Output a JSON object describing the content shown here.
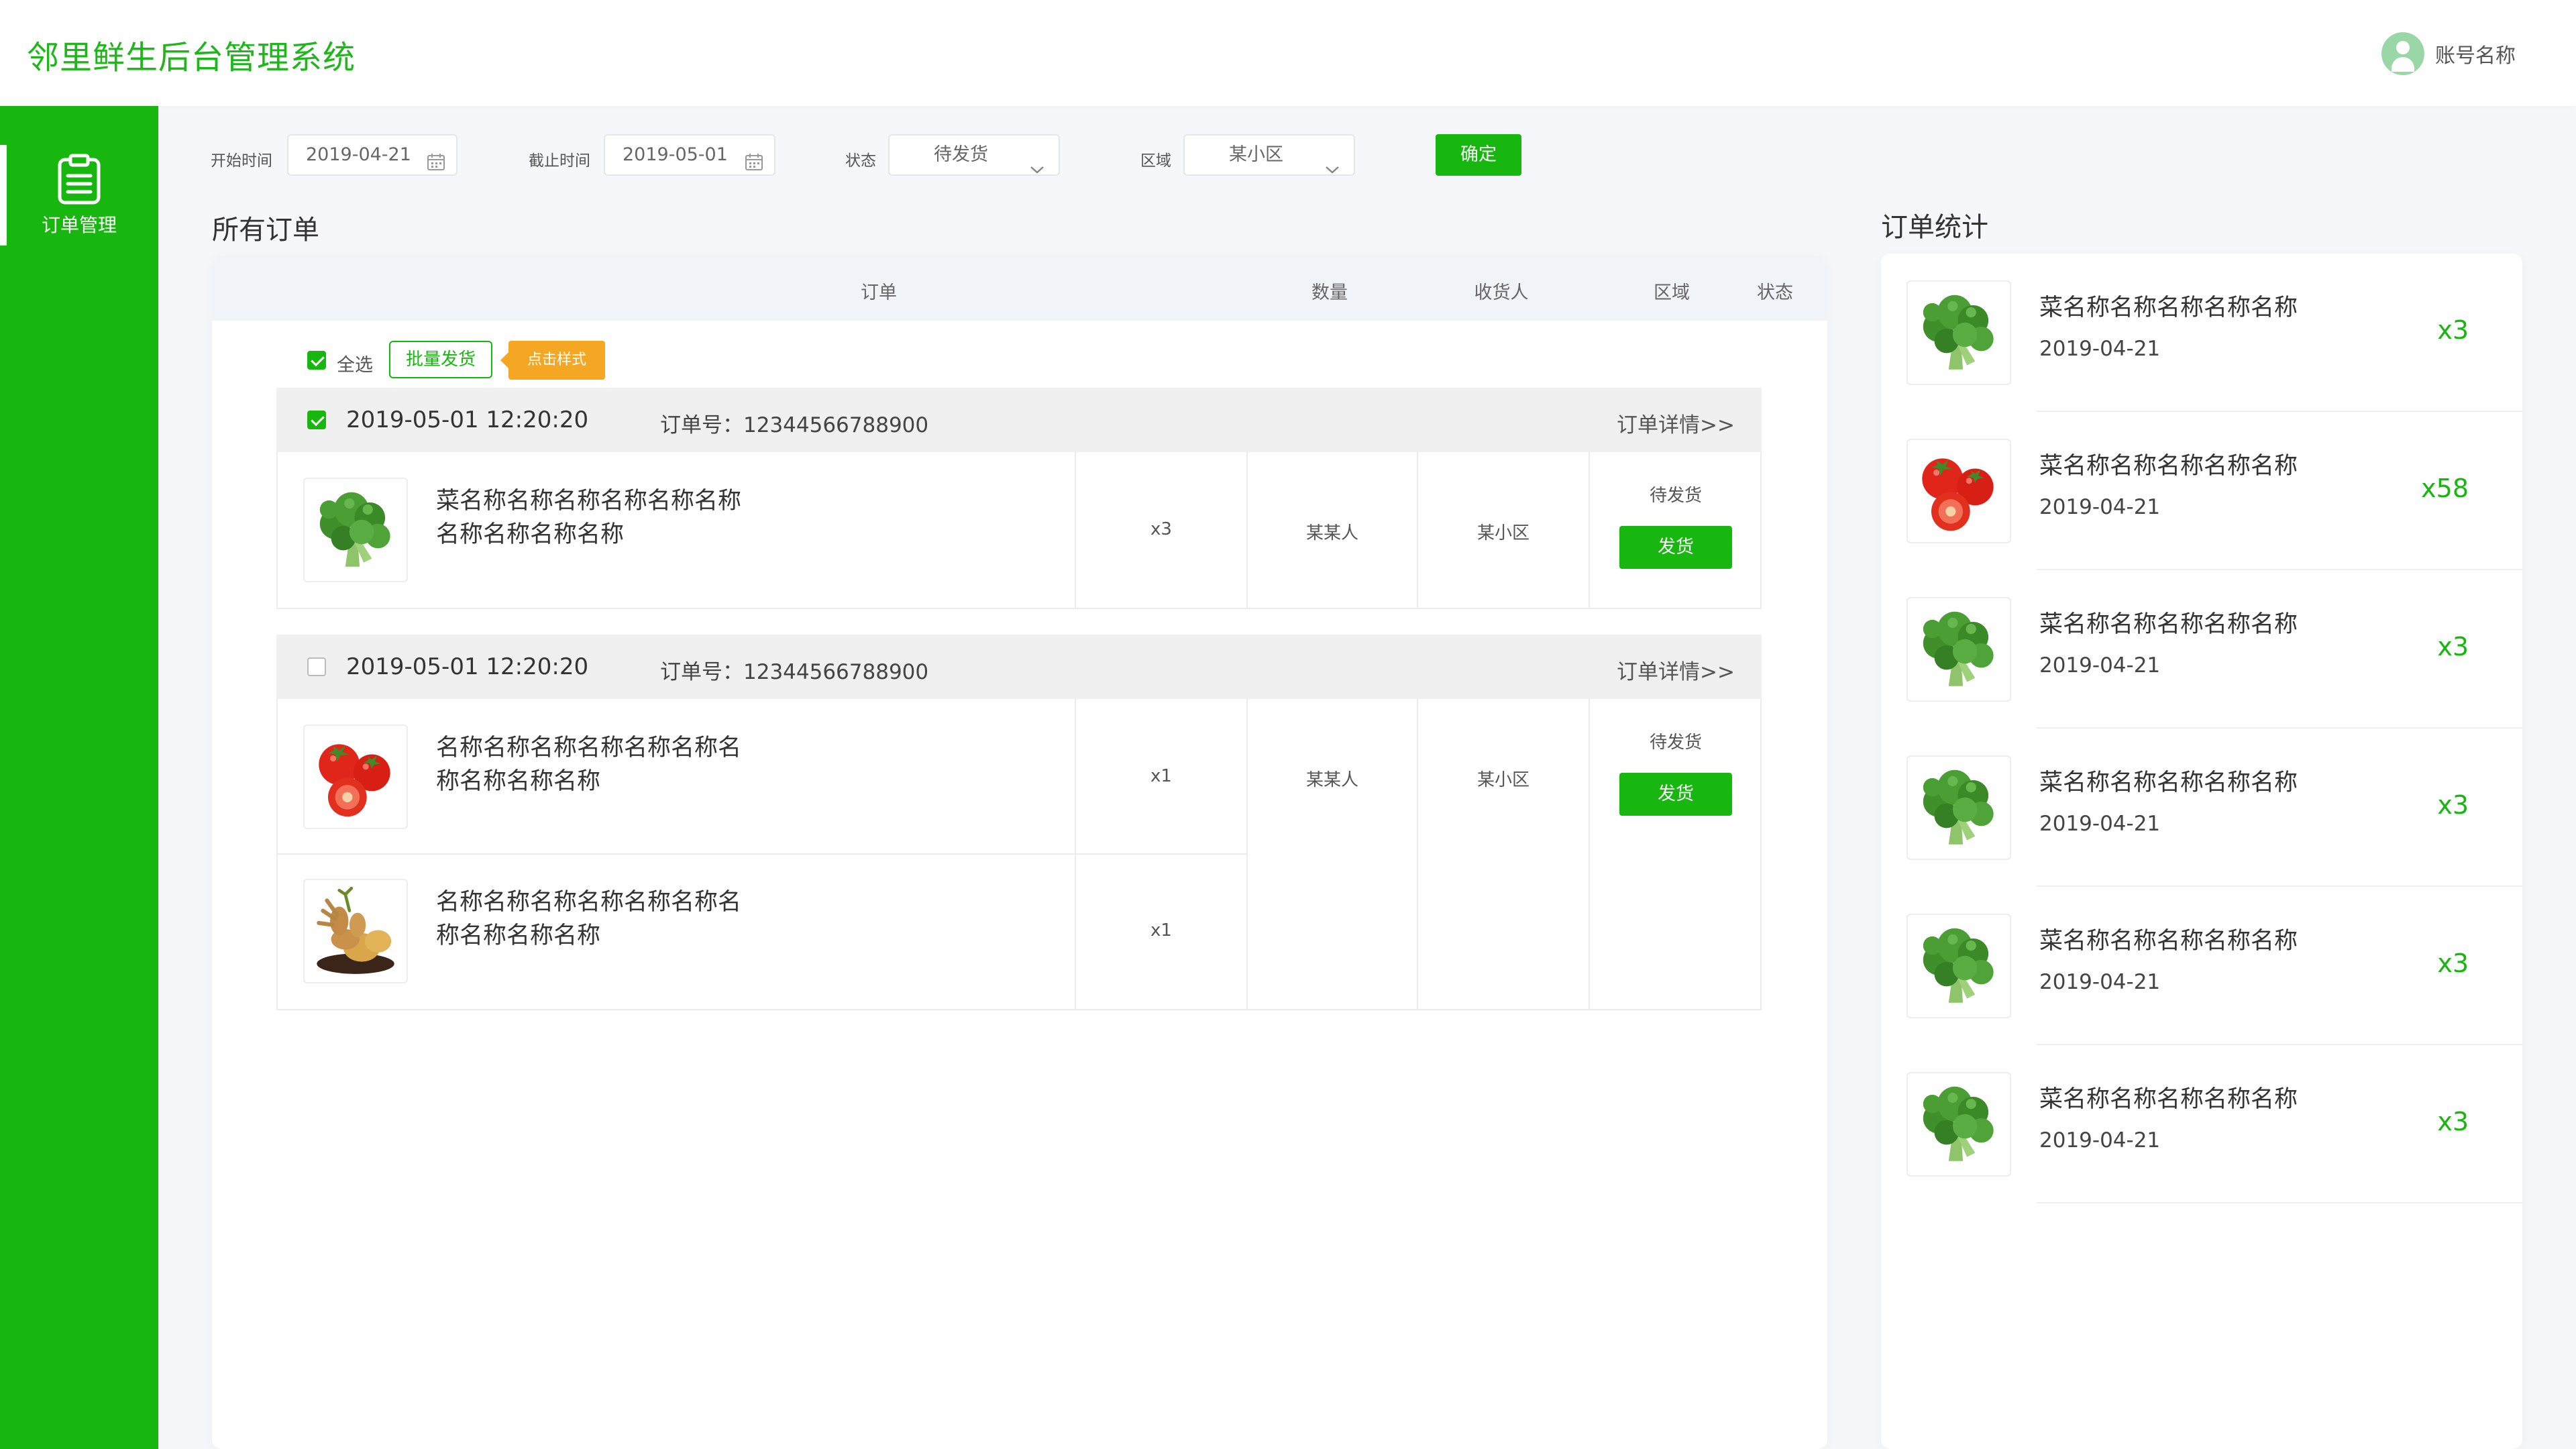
{
  "app": {
    "title": "邻里鲜生后台管理系统"
  },
  "account": {
    "name": "账号名称"
  },
  "sidebar": {
    "items": [
      {
        "label": "订单管理"
      }
    ]
  },
  "filters": {
    "start_label": "开始时间",
    "start_value": "2019-04-21",
    "end_label": "截止时间",
    "end_value": "2019-05-01",
    "status_label": "状态",
    "status_value": "待发货",
    "region_label": "区域",
    "region_value": "某小区",
    "confirm_label": "确定"
  },
  "orders": {
    "title": "所有订单",
    "columns": [
      "订单",
      "数量",
      "收货人",
      "区域",
      "状态"
    ],
    "select_all_label": "全选",
    "batch_label": "批量发货",
    "tip_label": "点击样式",
    "list": [
      {
        "checked": true,
        "time": "2019-05-01   12:20:20",
        "order_no": "订单号：12344566788900",
        "detail_link": "订单详情>>",
        "items": [
          {
            "image": "broccoli-image",
            "name": "菜名称名称名称名称名称名称名称名称名称名称",
            "qty": "x3"
          }
        ],
        "receiver": "某某人",
        "region": "某小区",
        "status": "待发货",
        "ship_label": "发货"
      },
      {
        "checked": false,
        "time": "2019-05-01   12:20:20",
        "order_no": "订单号：12344566788900",
        "detail_link": "订单详情>>",
        "items": [
          {
            "image": "tomato-image",
            "name": "名称名称名称名称名称名称名称名称名称名称",
            "qty": "x1"
          },
          {
            "image": "ginger-image",
            "name": "名称名称名称名称名称名称名称名称名称名称",
            "qty": "x1"
          }
        ],
        "receiver": "某某人",
        "region": "某小区",
        "status": "待发货",
        "ship_label": "发货"
      }
    ]
  },
  "stats": {
    "title": "订单统计",
    "items": [
      {
        "image": "broccoli-image",
        "name": "菜名称名称名称名称名称",
        "date": "2019-04-21",
        "qty": "x3"
      },
      {
        "image": "tomato-image",
        "name": "菜名称名称名称名称名称",
        "date": "2019-04-21",
        "qty": "x58"
      },
      {
        "image": "broccoli-image",
        "name": "菜名称名称名称名称名称",
        "date": "2019-04-21",
        "qty": "x3"
      },
      {
        "image": "broccoli-image",
        "name": "菜名称名称名称名称名称",
        "date": "2019-04-21",
        "qty": "x3"
      },
      {
        "image": "broccoli-image",
        "name": "菜名称名称名称名称名称",
        "date": "2019-04-21",
        "qty": "x3"
      },
      {
        "image": "broccoli-image",
        "name": "菜名称名称名称名称名称",
        "date": "2019-04-21",
        "qty": "x3"
      }
    ]
  },
  "colors": {
    "brand": "#17b70f",
    "accent_tip": "#f5a623"
  }
}
